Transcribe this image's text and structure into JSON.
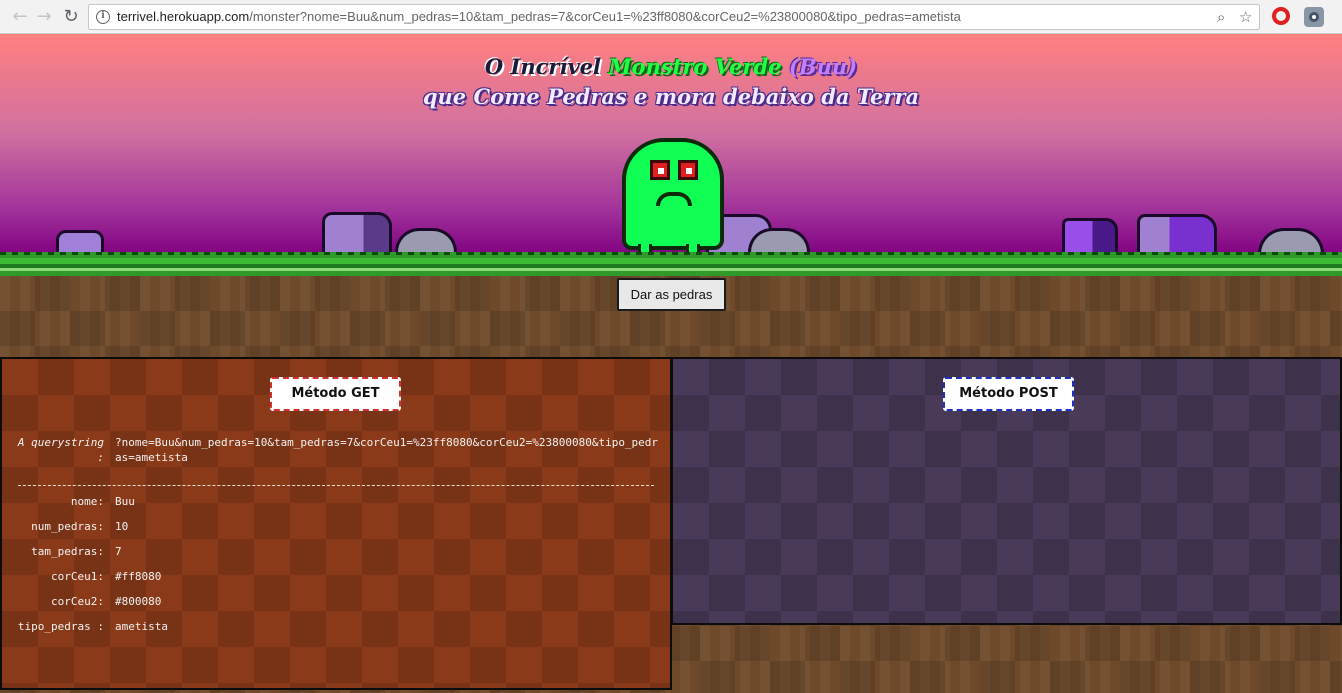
{
  "browser": {
    "url_host": "terrivel.herokuapp.com",
    "url_path": "/monster?nome=Buu&num_pedras=10&tam_pedras=7&corCeu1=%23ff8080&corCeu2=%23800080&tipo_pedras=ametista",
    "back_icon": "←",
    "forward_icon": "→",
    "reload_icon": "↻",
    "info_icon": "i",
    "zoom_icon": "⌕",
    "star_icon": "☆"
  },
  "title": {
    "line1_part1": "O Incrível",
    "line1_part2": "Monstro Verde",
    "line1_part3": "(Buu)",
    "line2": "que Come Pedras e mora debaixo da Terra"
  },
  "colors": {
    "sky_top": "#ff8080",
    "sky_bottom": "#800080",
    "monster": "#11ff55",
    "rock": "ametista"
  },
  "button": {
    "label": "Dar as pedras"
  },
  "get_panel": {
    "label": "Método GET",
    "querystring_key": "A querystring :",
    "querystring_value": "?nome=Buu&num_pedras=10&tam_pedras=7&corCeu1=%23ff8080&corCeu2=%23800080&tipo_pedras=ametista",
    "params": [
      {
        "key": "nome:",
        "value": "Buu"
      },
      {
        "key": "num_pedras:",
        "value": "10"
      },
      {
        "key": "tam_pedras:",
        "value": "7"
      },
      {
        "key": "corCeu1:",
        "value": "#ff8080"
      },
      {
        "key": "corCeu2:",
        "value": "#800080"
      },
      {
        "key": "tipo_pedras :",
        "value": "ametista"
      }
    ]
  },
  "post_panel": {
    "label": "Método POST"
  }
}
